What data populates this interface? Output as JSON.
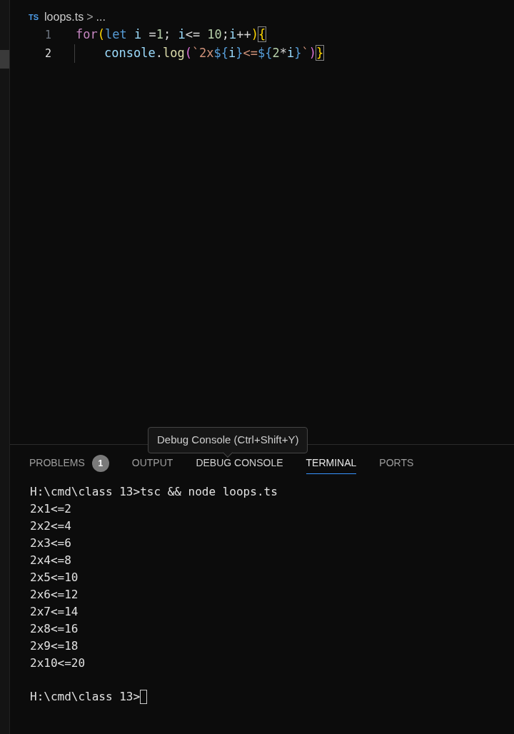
{
  "breadcrumb": {
    "file_badge": "TS",
    "file": "loops.ts",
    "separator": ">",
    "rest": "..."
  },
  "editor": {
    "lines": [
      {
        "number": "1",
        "current": false,
        "indented": false,
        "tokens": [
          {
            "text": "for",
            "kind": "keyword"
          },
          {
            "text": "(",
            "kind": "bracket"
          },
          {
            "text": "let",
            "kind": "storage"
          },
          {
            "text": " i ",
            "kind": "variable"
          },
          {
            "text": "=",
            "kind": "plain"
          },
          {
            "text": "1",
            "kind": "number"
          },
          {
            "text": "; ",
            "kind": "plain"
          },
          {
            "text": "i",
            "kind": "variable"
          },
          {
            "text": "<= ",
            "kind": "plain"
          },
          {
            "text": "10",
            "kind": "number"
          },
          {
            "text": ";",
            "kind": "plain"
          },
          {
            "text": "i",
            "kind": "variable"
          },
          {
            "text": "++",
            "kind": "plain"
          },
          {
            "text": ")",
            "kind": "bracket"
          },
          {
            "text": "{",
            "kind": "bracket-match"
          }
        ]
      },
      {
        "number": "2",
        "current": true,
        "indented": true,
        "tokens": [
          {
            "text": "console",
            "kind": "variable"
          },
          {
            "text": ".",
            "kind": "plain"
          },
          {
            "text": "log",
            "kind": "function"
          },
          {
            "text": "(",
            "kind": "bracket2"
          },
          {
            "text": "`2x",
            "kind": "string"
          },
          {
            "text": "${",
            "kind": "interp"
          },
          {
            "text": "i",
            "kind": "variable"
          },
          {
            "text": "}",
            "kind": "interp"
          },
          {
            "text": "<=",
            "kind": "string"
          },
          {
            "text": "${",
            "kind": "interp"
          },
          {
            "text": "2",
            "kind": "number"
          },
          {
            "text": "*",
            "kind": "plain"
          },
          {
            "text": "i",
            "kind": "variable"
          },
          {
            "text": "}",
            "kind": "interp"
          },
          {
            "text": "`",
            "kind": "string"
          },
          {
            "text": ")",
            "kind": "bracket2"
          },
          {
            "text": "}",
            "kind": "bracket-match"
          }
        ]
      }
    ]
  },
  "tooltip": "Debug Console (Ctrl+Shift+Y)",
  "panel_tabs": [
    {
      "label": "PROBLEMS",
      "badge": "1",
      "selected": false
    },
    {
      "label": "OUTPUT",
      "selected": false
    },
    {
      "label": "DEBUG CONSOLE",
      "selected": false
    },
    {
      "label": "TERMINAL",
      "selected": true
    },
    {
      "label": "PORTS",
      "selected": false
    }
  ],
  "terminal": {
    "lines": [
      "H:\\cmd\\class 13>tsc && node loops.ts",
      "2x1<=2",
      "2x2<=4",
      "2x3<=6",
      "2x4<=8",
      "2x5<=10",
      "2x6<=12",
      "2x7<=14",
      "2x8<=16",
      "2x9<=18",
      "2x10<=20"
    ],
    "prompt": "H:\\cmd\\class 13>"
  }
}
